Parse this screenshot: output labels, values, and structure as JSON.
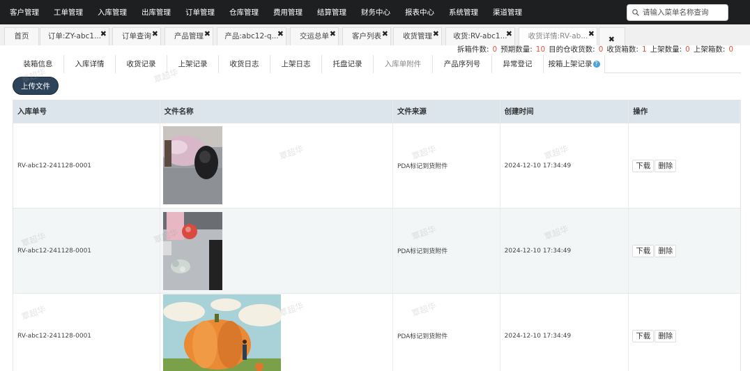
{
  "top_menu": [
    "客户管理",
    "工单管理",
    "入库管理",
    "出库管理",
    "订单管理",
    "仓库管理",
    "费用管理",
    "结算管理",
    "财务中心",
    "报表中心",
    "系统管理",
    "渠道管理"
  ],
  "search": {
    "placeholder": "请输入菜单名称查询",
    "icon": "search-icon"
  },
  "page_tabs": [
    {
      "label": "首页",
      "closable": false
    },
    {
      "label": "订单:ZY-abc1...",
      "closable": true
    },
    {
      "label": "订单查询",
      "closable": true
    },
    {
      "label": "产品管理",
      "closable": true
    },
    {
      "label": "产品:abc12-q...",
      "closable": true
    },
    {
      "label": "交运总单",
      "closable": true
    },
    {
      "label": "客户列表",
      "closable": true
    },
    {
      "label": "收货管理",
      "closable": true
    },
    {
      "label": "收货:RV-abc1...",
      "closable": true
    },
    {
      "label": "收货详情:RV-ab...",
      "closable": true,
      "active": true
    },
    {
      "label": "",
      "closable": true
    }
  ],
  "stats": [
    {
      "label": "拆箱件数:",
      "value": "0"
    },
    {
      "label": "预期数量:",
      "value": "10"
    },
    {
      "label": "目的仓收货数:",
      "value": "0"
    },
    {
      "label": "收货箱数:",
      "value": "1"
    },
    {
      "label": "上架数量:",
      "value": "0"
    },
    {
      "label": "上架箱数:",
      "value": "0"
    }
  ],
  "sub_tabs": [
    "装箱信息",
    "入库详情",
    "收货记录",
    "上架记录",
    "收货日志",
    "上架日志",
    "托盘记录",
    "入库单附件",
    "产品序列号",
    "异常登记",
    "按箱上架记录"
  ],
  "sub_tab_active": 7,
  "upload_label": "上传文件",
  "table": {
    "headers": [
      "入库单号",
      "文件名称",
      "文件来源",
      "创建时间",
      "操作"
    ],
    "rows": [
      {
        "order": "RV-abc12-241128-0001",
        "image": "mouse-photo",
        "source": "PDA标记到货附件",
        "created": "2024-12-10 17:34:49",
        "download": "下载",
        "delete": "删除"
      },
      {
        "order": "RV-abc12-241128-0001",
        "image": "desk-items-photo",
        "source": "PDA标记到货附件",
        "created": "2024-12-10 17:34:49",
        "download": "下载",
        "delete": "删除"
      },
      {
        "order": "RV-abc12-241128-0001",
        "image": "pumpkin-illustration",
        "source": "PDA标记到货附件",
        "created": "2024-12-10 17:34:49",
        "download": "下载",
        "delete": "删除"
      }
    ]
  },
  "watermark": "覃超华",
  "colors": {
    "nav_bg": "#1e1f20",
    "header_bg": "#dde5ec",
    "stat_num": "#e5533b",
    "upload_btn": "#2d4359"
  }
}
